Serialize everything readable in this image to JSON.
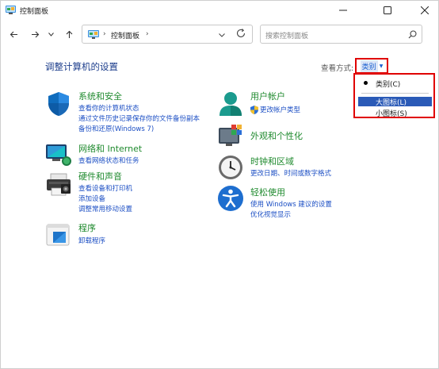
{
  "window": {
    "title": "控制面板",
    "minimize_icon": "minimize-icon",
    "maximize_icon": "maximize-icon",
    "close_icon": "close-icon"
  },
  "nav": {
    "breadcrumb_sep": "›",
    "address": "控制面板",
    "search_placeholder": "搜索控制面板"
  },
  "header": {
    "title": "调整计算机的设置",
    "view_by_label": "查看方式:",
    "view_by_value": "类别"
  },
  "view_menu": {
    "items": [
      {
        "label": "类别(C)",
        "selected": true
      },
      {
        "label": "大图标(L)",
        "highlighted": true
      },
      {
        "label": "小图标(S)"
      }
    ]
  },
  "categories": {
    "left": [
      {
        "title": "系统和安全",
        "icon": "shield-icon",
        "links": [
          "查看你的计算机状态",
          "通过文件历史记录保存你的文件备份副本",
          "备份和还原(Windows 7)"
        ]
      },
      {
        "title": "网络和 Internet",
        "icon": "network-icon",
        "links": [
          "查看网络状态和任务"
        ]
      },
      {
        "title": "硬件和声音",
        "icon": "printer-icon",
        "links": [
          "查看设备和打印机",
          "添加设备",
          "调整常用移动设置"
        ]
      },
      {
        "title": "程序",
        "icon": "programs-icon",
        "links": [
          "卸载程序"
        ]
      }
    ],
    "right": [
      {
        "title": "用户帐户",
        "icon": "user-icon",
        "links": [
          "更改帐户类型"
        ]
      },
      {
        "title": "外观和个性化",
        "icon": "appearance-icon",
        "links": []
      },
      {
        "title": "时钟和区域",
        "icon": "clock-icon",
        "links": [
          "更改日期、时间或数字格式"
        ]
      },
      {
        "title": "轻松使用",
        "icon": "accessibility-icon",
        "links": [
          "使用 Windows 建议的设置",
          "优化视觉显示"
        ]
      }
    ]
  },
  "colors": {
    "accent": "#1c4fc4",
    "category_green": "#1f8a2e",
    "highlight_red": "#e00000",
    "menu_highlight": "#2a5ab7"
  }
}
